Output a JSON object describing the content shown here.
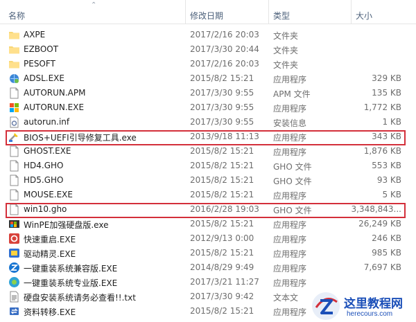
{
  "header": {
    "col_name": "名称",
    "col_date": "修改日期",
    "col_type": "类型",
    "col_size": "大小"
  },
  "files": [
    {
      "name": "AXPE",
      "date": "2017/2/16 20:03",
      "type": "文件夹",
      "size": "",
      "icon": "folder-icon"
    },
    {
      "name": "EZBOOT",
      "date": "2017/3/30 20:44",
      "type": "文件夹",
      "size": "",
      "icon": "folder-icon"
    },
    {
      "name": "PESOFT",
      "date": "2017/2/16 20:03",
      "type": "文件夹",
      "size": "",
      "icon": "folder-icon"
    },
    {
      "name": "ADSL.EXE",
      "date": "2015/8/2 15:21",
      "type": "应用程序",
      "size": "329 KB",
      "icon": "network-app-icon"
    },
    {
      "name": "AUTORUN.APM",
      "date": "2017/3/30 9:55",
      "type": "APM 文件",
      "size": "135 KB",
      "icon": "file-icon"
    },
    {
      "name": "AUTORUN.EXE",
      "date": "2017/3/30 9:55",
      "type": "应用程序",
      "size": "1,772 KB",
      "icon": "windows-app-icon"
    },
    {
      "name": "autorun.inf",
      "date": "2017/3/30 9:55",
      "type": "安装信息",
      "size": "1 KB",
      "icon": "settings-file-icon"
    },
    {
      "name": "BIOS+UEFI引导修复工具.exe",
      "date": "2013/9/18 11:13",
      "type": "应用程序",
      "size": "343 KB",
      "icon": "repair-tool-icon"
    },
    {
      "name": "GHOST.EXE",
      "date": "2015/8/2 15:21",
      "type": "应用程序",
      "size": "1,876 KB",
      "icon": "file-icon"
    },
    {
      "name": "HD4.GHO",
      "date": "2015/8/2 15:21",
      "type": "GHO 文件",
      "size": "553 KB",
      "icon": "file-icon"
    },
    {
      "name": "HD5.GHO",
      "date": "2015/8/2 15:21",
      "type": "GHO 文件",
      "size": "93 KB",
      "icon": "file-icon"
    },
    {
      "name": "MOUSE.EXE",
      "date": "2015/8/2 15:21",
      "type": "应用程序",
      "size": "5 KB",
      "icon": "file-icon"
    },
    {
      "name": "win10.gho",
      "date": "2016/2/28 19:03",
      "type": "GHO 文件",
      "size": "3,348,843...",
      "icon": "file-icon"
    },
    {
      "name": "WinPE加强硬盘版.exe",
      "date": "2015/8/2 15:21",
      "type": "应用程序",
      "size": "26,249 KB",
      "icon": "winpe-app-icon"
    },
    {
      "name": "快速重启.EXE",
      "date": "2012/9/13 0:00",
      "type": "应用程序",
      "size": "246 KB",
      "icon": "restart-app-icon"
    },
    {
      "name": "驱动精灵.EXE",
      "date": "2015/8/2 15:21",
      "type": "应用程序",
      "size": "985 KB",
      "icon": "driver-app-icon"
    },
    {
      "name": "一键重装系统兼容版.EXE",
      "date": "2014/8/29 9:49",
      "type": "应用程序",
      "size": "7,697 KB",
      "icon": "reinstall-app-icon"
    },
    {
      "name": "一键重装系统专业版.EXE",
      "date": "2017/3/21 11:27",
      "type": "应用程序",
      "size": "",
      "icon": "reinstall-pro-app-icon"
    },
    {
      "name": "硬盘安装系统请务必查看!!.txt",
      "date": "2017/3/30 9:42",
      "type": "文本文",
      "size": "",
      "icon": "text-file-icon"
    },
    {
      "name": "资料转移.EXE",
      "date": "2015/8/2 15:21",
      "type": "应用程序",
      "size": "",
      "icon": "transfer-app-icon"
    }
  ],
  "highlight_color": "#d32f3a",
  "watermark": {
    "title": "这里教程网",
    "subtitle": "herecours.com"
  }
}
